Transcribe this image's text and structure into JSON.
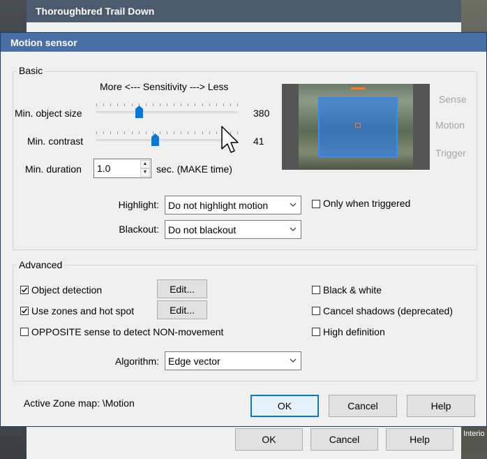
{
  "back_window": {
    "title": "Thoroughbred Trail Down",
    "ok_label": "OK",
    "cancel_label": "Cancel",
    "help_label": "Help"
  },
  "background": {
    "right_label": "Interio"
  },
  "dialog": {
    "title": "Motion sensor",
    "basic": {
      "legend": "Basic",
      "sensitivity_header": "More <--- Sensitivity ---> Less",
      "min_object_size_label": "Min. object size",
      "min_object_size_value": "380",
      "min_object_size_level": 0.29,
      "min_contrast_label": "Min. contrast",
      "min_contrast_value": "41",
      "min_contrast_level": 0.41,
      "min_duration_label": "Min. duration",
      "min_duration_value": "1.0",
      "min_duration_unit": "sec.  (MAKE time)",
      "highlight_label": "Highlight:",
      "highlight_value": "Do not highlight motion",
      "only_when_triggered_label": "Only when triggered",
      "only_when_triggered_checked": false,
      "blackout_label": "Blackout:",
      "blackout_value": "Do not blackout",
      "indicators": [
        "Sense",
        "Motion",
        "Trigger"
      ]
    },
    "advanced": {
      "legend": "Advanced",
      "object_detection_label": "Object detection",
      "object_detection_checked": true,
      "use_zones_label": "Use zones and hot spot",
      "use_zones_checked": true,
      "opposite_label": "OPPOSITE sense to detect NON-movement",
      "opposite_checked": false,
      "edit_label_1": "Edit...",
      "edit_label_2": "Edit...",
      "black_white_label": "Black & white",
      "black_white_checked": false,
      "cancel_shadows_label": "Cancel shadows (deprecated)",
      "cancel_shadows_checked": false,
      "high_definition_label": "High definition",
      "high_definition_checked": false,
      "algorithm_label": "Algorithm:",
      "algorithm_value": "Edge vector"
    },
    "active_zone_map": "Active Zone map:  \\Motion",
    "ok_label": "OK",
    "cancel_label": "Cancel",
    "help_label": "Help"
  },
  "colors": {
    "title_bar": "#4a6fa6",
    "accent": "#0078d7",
    "zone_overlay": "#2f8dff",
    "indicator_inactive": "#a6a6a6"
  }
}
